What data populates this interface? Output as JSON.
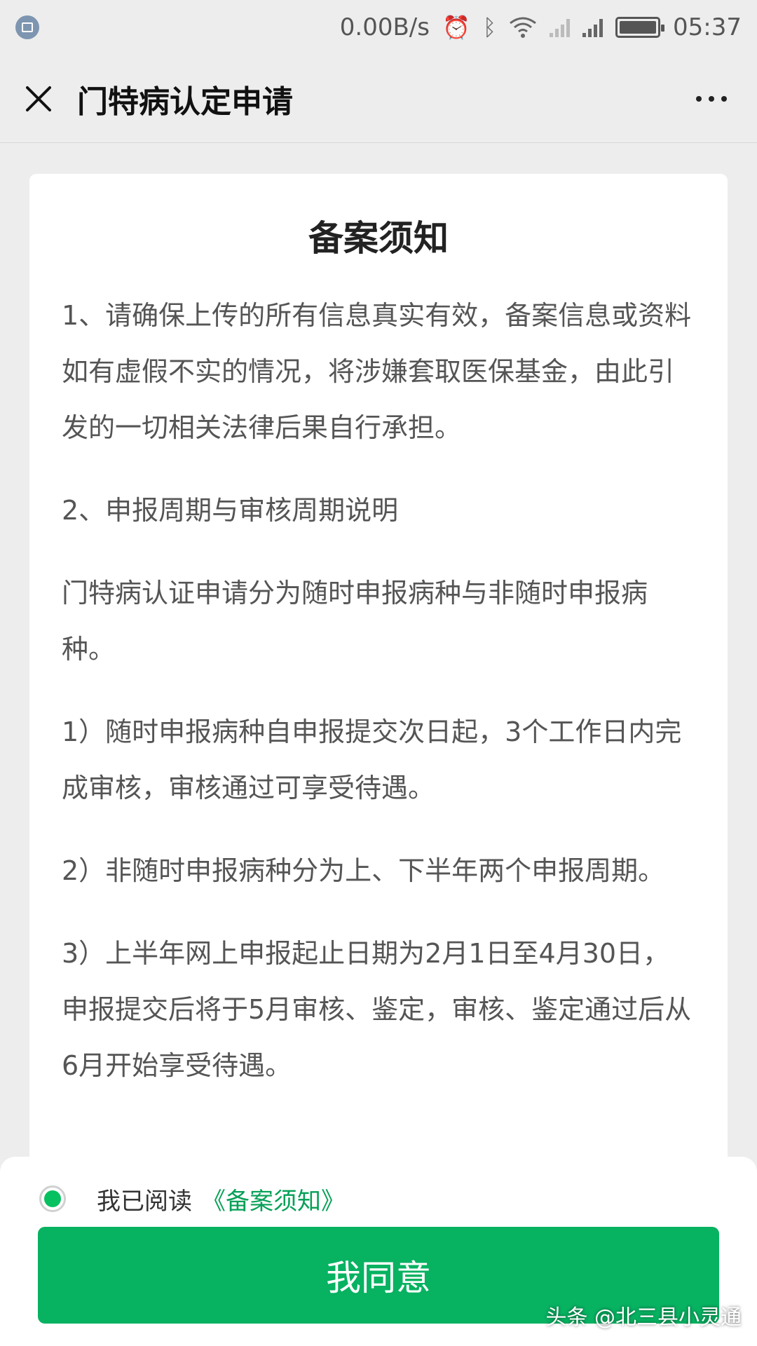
{
  "status_bar": {
    "network_speed": "0.00B/s",
    "time": "05:37",
    "icons": [
      "screenshot-icon",
      "alarm-icon",
      "bluetooth-icon",
      "wifi-icon",
      "signal-icon",
      "signal-icon",
      "battery-icon"
    ]
  },
  "header": {
    "title": "门特病认定申请",
    "close_icon": "close-icon",
    "more_icon": "more-icon"
  },
  "notice": {
    "title": "备案须知",
    "paragraphs": [
      "1、请确保上传的所有信息真实有效，备案信息或资料如有虚假不实的情况，将涉嫌套取医保基金，由此引发的一切相关法律后果自行承担。",
      "2、申报周期与审核周期说明",
      "门特病认证申请分为随时申报病种与非随时申报病种。",
      "1）随时申报病种自申报提交次日起，3个工作日内完成审核，审核通过可享受待遇。",
      "2）非随时申报病种分为上、下半年两个申报周期。",
      "3）上半年网上申报起止日期为2月1日至4月30日，申报提交后将于5月审核、鉴定，审核、鉴定通过后从6月开始享受待遇。"
    ]
  },
  "footer": {
    "agree_prefix": "我已阅读",
    "agree_link": "《备案须知》",
    "agree_checked": true,
    "button_label": "我同意"
  },
  "watermark": "头条 @北三县小灵通",
  "colors": {
    "accent": "#07b261",
    "link": "#07a057",
    "background": "#ededed"
  }
}
